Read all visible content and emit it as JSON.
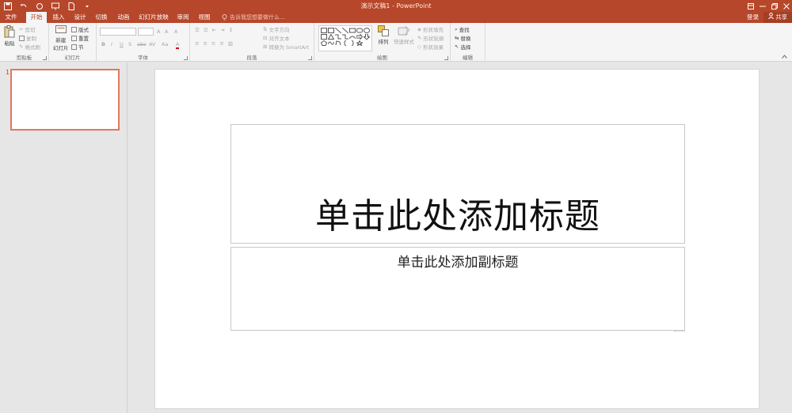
{
  "window": {
    "title": "演示文稿1 - PowerPoint"
  },
  "tabs": [
    {
      "label": "文件"
    },
    {
      "label": "开始"
    },
    {
      "label": "插入"
    },
    {
      "label": "设计"
    },
    {
      "label": "切换"
    },
    {
      "label": "动画"
    },
    {
      "label": "幻灯片放映"
    },
    {
      "label": "审阅"
    },
    {
      "label": "视图"
    }
  ],
  "active_tab": "开始",
  "tell_me": "告诉我您想要做什么...",
  "account": {
    "signin": "登录",
    "share": "共享"
  },
  "ribbon": {
    "clipboard": {
      "label": "剪贴板",
      "paste": "粘贴",
      "cut": "剪切",
      "copy": "复制",
      "format_painter": "格式刷"
    },
    "slides": {
      "label": "幻灯片",
      "new_slide": "新建",
      "new_slide2": "幻灯片",
      "layout": "版式",
      "reset": "重置",
      "section": "节"
    },
    "font": {
      "label": "字体",
      "bold": "B",
      "italic": "I",
      "underline": "U",
      "strike": "S",
      "abc": "abc",
      "spacing": "AV",
      "case": "Aa",
      "grow": "A",
      "shrink": "A",
      "clear": "A"
    },
    "paragraph": {
      "label": "段落",
      "text_direction": "文字方向",
      "align_text": "对齐文本",
      "smartart": "转换为 SmartArt"
    },
    "drawing": {
      "label": "绘图",
      "arrange": "排列",
      "quick_styles": "快速样式",
      "shape_fill": "形状填充",
      "shape_outline": "形状轮廓",
      "shape_effects": "形状效果"
    },
    "editing": {
      "label": "编辑",
      "find": "查找",
      "replace": "替换",
      "select": "选择"
    }
  },
  "thumbnails": [
    {
      "number": "1"
    }
  ],
  "slide": {
    "title_placeholder": "单击此处添加标题",
    "subtitle_placeholder": "单击此处添加副标题"
  },
  "colors": {
    "accent": "#b7472a",
    "thumb_border": "#e0785c"
  },
  "icons": [
    "save-icon",
    "undo-icon",
    "redo-icon",
    "present-icon",
    "new-doc-icon",
    "lightbulb-icon",
    "person-icon"
  ]
}
